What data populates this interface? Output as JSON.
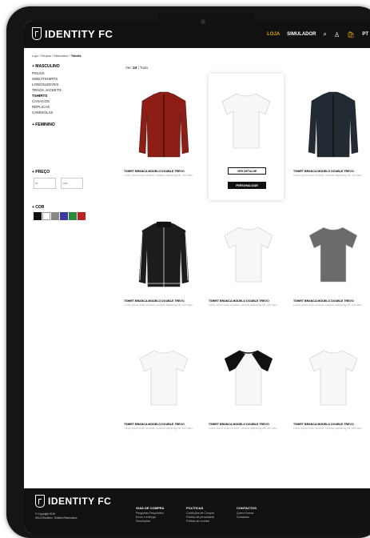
{
  "header": {
    "brand": "IDENTITY FC",
    "nav": [
      {
        "label": "LOJA",
        "active": true
      },
      {
        "label": "SIMULADOR",
        "active": false
      }
    ],
    "icons": [
      "search-icon",
      "user-icon",
      "bag-icon"
    ],
    "bag_count": "",
    "lang": "PT"
  },
  "breadcrumb": {
    "path": "Loja / Grupos / Masculino / ",
    "current": "Tshirts"
  },
  "sidebar": {
    "section": "+ MASCULINO",
    "items": [
      "POLOS",
      "SWEATSHIRTS",
      "LONGSLEEVES",
      "TRACK JACKETS",
      "TSHIRTS",
      "CASACOS",
      "RÉPLICAS",
      "CAMISOLAS"
    ],
    "selected": "TSHIRTS",
    "female": "+ FEMININO",
    "price_label": "+ PREÇO",
    "price_min_placeholder": "0€",
    "price_max_placeholder": "100€",
    "color_label": "+ COR",
    "colors": [
      "#111111",
      "#ffffff",
      "#888888",
      "#3a3aa0",
      "#2c8a3c",
      "#c02020"
    ]
  },
  "listing": {
    "view_label": "Ver: ",
    "view_24": "24",
    "view_sep": " | ",
    "view_all": "Tudo"
  },
  "products": [
    {
      "title": "TSHIRT BRANCA MODELO DOUBLE TREVO",
      "desc": "Lorem ipsum dolor sit amet, consect adipiscing elit, sed diam",
      "shirt": "jacket-red"
    },
    {
      "title": "TSHIRT BRANCA MODELO DOUBLE TREVO",
      "desc": "Lorem ipsum dolor sit amet, consect adipiscing elit, sed diam",
      "shirt": "tee-white"
    },
    {
      "title": "TSHIRT BRANCA MODELO DOUBLE TREVO",
      "desc": "Lorem ipsum dolor sit amet, consect adipiscing elit, sed diam",
      "shirt": "jacket-black"
    },
    {
      "title": "TSHIRT BRANCA MODELO DOUBLE TREVO",
      "desc": "Lorem ipsum dolor sit amet, consect adipiscing elit, sed diam",
      "shirt": "track-black"
    },
    {
      "title": "TSHIRT BRANCA MODELO DOUBLE TREVO",
      "desc": "Lorem ipsum dolor sit amet, consect adipiscing elit, sed diam",
      "shirt": "tee-white"
    },
    {
      "title": "TSHIRT BRANCA MODELO DOUBLE TREVO",
      "desc": "Lorem ipsum dolor sit amet, consect adipiscing elit, sed diam",
      "shirt": "tee-grey"
    },
    {
      "title": "TSHIRT BRANCA MODELO DOUBLE TREVO",
      "desc": "Lorem ipsum dolor sit amet, consect adipiscing elit, sed diam",
      "shirt": "tee-white"
    },
    {
      "title": "TSHIRT BRANCA MODELO DOUBLE TREVO",
      "desc": "Lorem ipsum dolor sit amet, consect adipiscing elit, sed diam",
      "shirt": "raglan"
    },
    {
      "title": "TSHIRT BRANCA MODELO DOUBLE TREVO",
      "desc": "Lorem ipsum dolor sit amet, consect adipiscing elit, sed diam",
      "shirt": "tee-white"
    }
  ],
  "card_actions": {
    "detail": "VER DETALHE",
    "custom": "PERSONALIZAR"
  },
  "footer": {
    "brand": "IDENTITY FC",
    "copyright": "© Copyright 2016",
    "rights": "HELIOTuniform, Direitos Reservados",
    "cols": [
      {
        "title": "GUIA DE COMPRA",
        "links": [
          "Perguntas Frequentes",
          "Envio e entrega",
          "Devoluções"
        ]
      },
      {
        "title": "POLÍTICAS",
        "links": [
          "Condições de Compra",
          "Política de privacidade",
          "Política de cookies"
        ]
      },
      {
        "title": "CONTACTOS",
        "links": [
          "Quem Somos",
          "Contactos"
        ]
      }
    ]
  }
}
